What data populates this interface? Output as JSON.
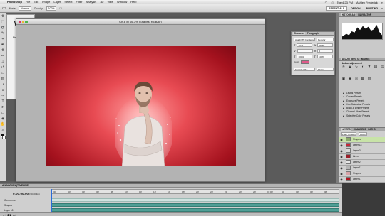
{
  "menubar": {
    "app": "Photoshop",
    "items": [
      "File",
      "Edit",
      "Image",
      "Layer",
      "Select",
      "Filter",
      "Analysis",
      "3D",
      "View",
      "Window",
      "Help"
    ],
    "clock": "Tue 4:23 PM",
    "user": "Ashley Frederick"
  },
  "options": {
    "mode_label": "Mode:",
    "mode_value": "Normal",
    "opacity_label": "Opacity:",
    "opacity_value": "100%",
    "workspaces": [
      "ESSENTIALS",
      "DESIGN",
      "PAINTING"
    ],
    "active_workspace": "ESSENTIALS"
  },
  "document": {
    "title": "Ch-p @ 66.7% (Shapes, RGB/8*)",
    "bg_title": "We",
    "bg_sub": "Pro"
  },
  "character_panel": {
    "tabs": [
      "Character",
      "Paragraph"
    ],
    "font": "Abadi MT Condensed",
    "style": "Regular",
    "size": "36 pt",
    "leading": "(Auto)",
    "tracking": "0",
    "scale_v": "100%",
    "scale_h": "100%",
    "color_label": "Color:",
    "lang": "English: USA",
    "aa": "Sharp"
  },
  "right_panel": {
    "top_tabs": [
      "HISTOGRAM",
      "NAVIGATOR"
    ],
    "adj_tabs": [
      "ADJUSTMENTS",
      "MASKS"
    ],
    "adj_title": "Add an adjustment",
    "presets": [
      "Levels Presets",
      "Curves Presets",
      "Exposure Presets",
      "Hue/Saturation Presets",
      "Black & White Presets",
      "Channel Mixer Presets",
      "Selective Color Presets"
    ],
    "layer_tabs": [
      "LAYERS",
      "CHANNELS",
      "PATHS"
    ],
    "blend": "Pass Through",
    "opacity": "100%",
    "layers": [
      "Shapes",
      "Layer 18",
      "Layer 3",
      "Lines",
      "Layer 2",
      "Layer 11",
      "Shapes",
      "Layer 1"
    ],
    "selected_layer": "Shapes"
  },
  "timeline": {
    "title": "ANIMATION (TIMELINE)",
    "timecode": "0:00:00:00",
    "fps": "(30.00 fps)",
    "ticks": [
      "00",
      "02f",
      "04f",
      "06f",
      "08f",
      "10f",
      "12f",
      "14f",
      "16f",
      "18f",
      "20f",
      "22f",
      "24f",
      "26f",
      "28f",
      "01:00f",
      "02f",
      "04f",
      "06f",
      "08f"
    ],
    "tracks": [
      "Comments",
      "Shapes",
      "Layer 18"
    ]
  }
}
